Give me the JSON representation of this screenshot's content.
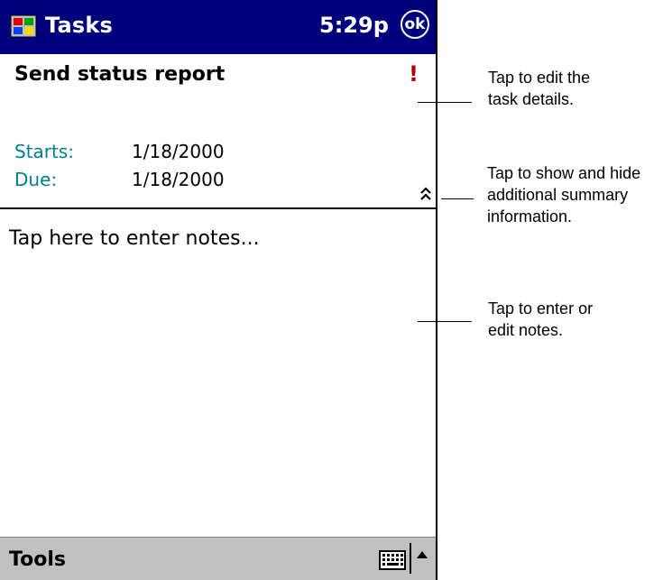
{
  "titlebar": {
    "app_title": "Tasks",
    "time": "5:29p",
    "ok_label": "ok"
  },
  "task": {
    "subject": "Send status report",
    "priority_glyph": "!",
    "starts_label": "Starts:",
    "starts_value": "1/18/2000",
    "due_label": "Due:",
    "due_value": "1/18/2000"
  },
  "notes": {
    "placeholder": "Tap here to enter notes..."
  },
  "bottombar": {
    "menu_label": "Tools"
  },
  "callouts": {
    "edit_details": "Tap to edit the\ntask details.",
    "toggle_summary": "Tap to show and hide\nadditional summary\ninformation.",
    "edit_notes": "Tap to enter or\nedit notes."
  },
  "colors": {
    "titlebar": "#00007c",
    "label": "#00808e",
    "priority": "#b00000",
    "bottombar": "#c0c0c0"
  },
  "icons": [
    "windows-start-icon",
    "ok-icon",
    "priority-high-icon",
    "chevron-up-double-icon",
    "keyboard-icon",
    "up-arrow-icon"
  ]
}
